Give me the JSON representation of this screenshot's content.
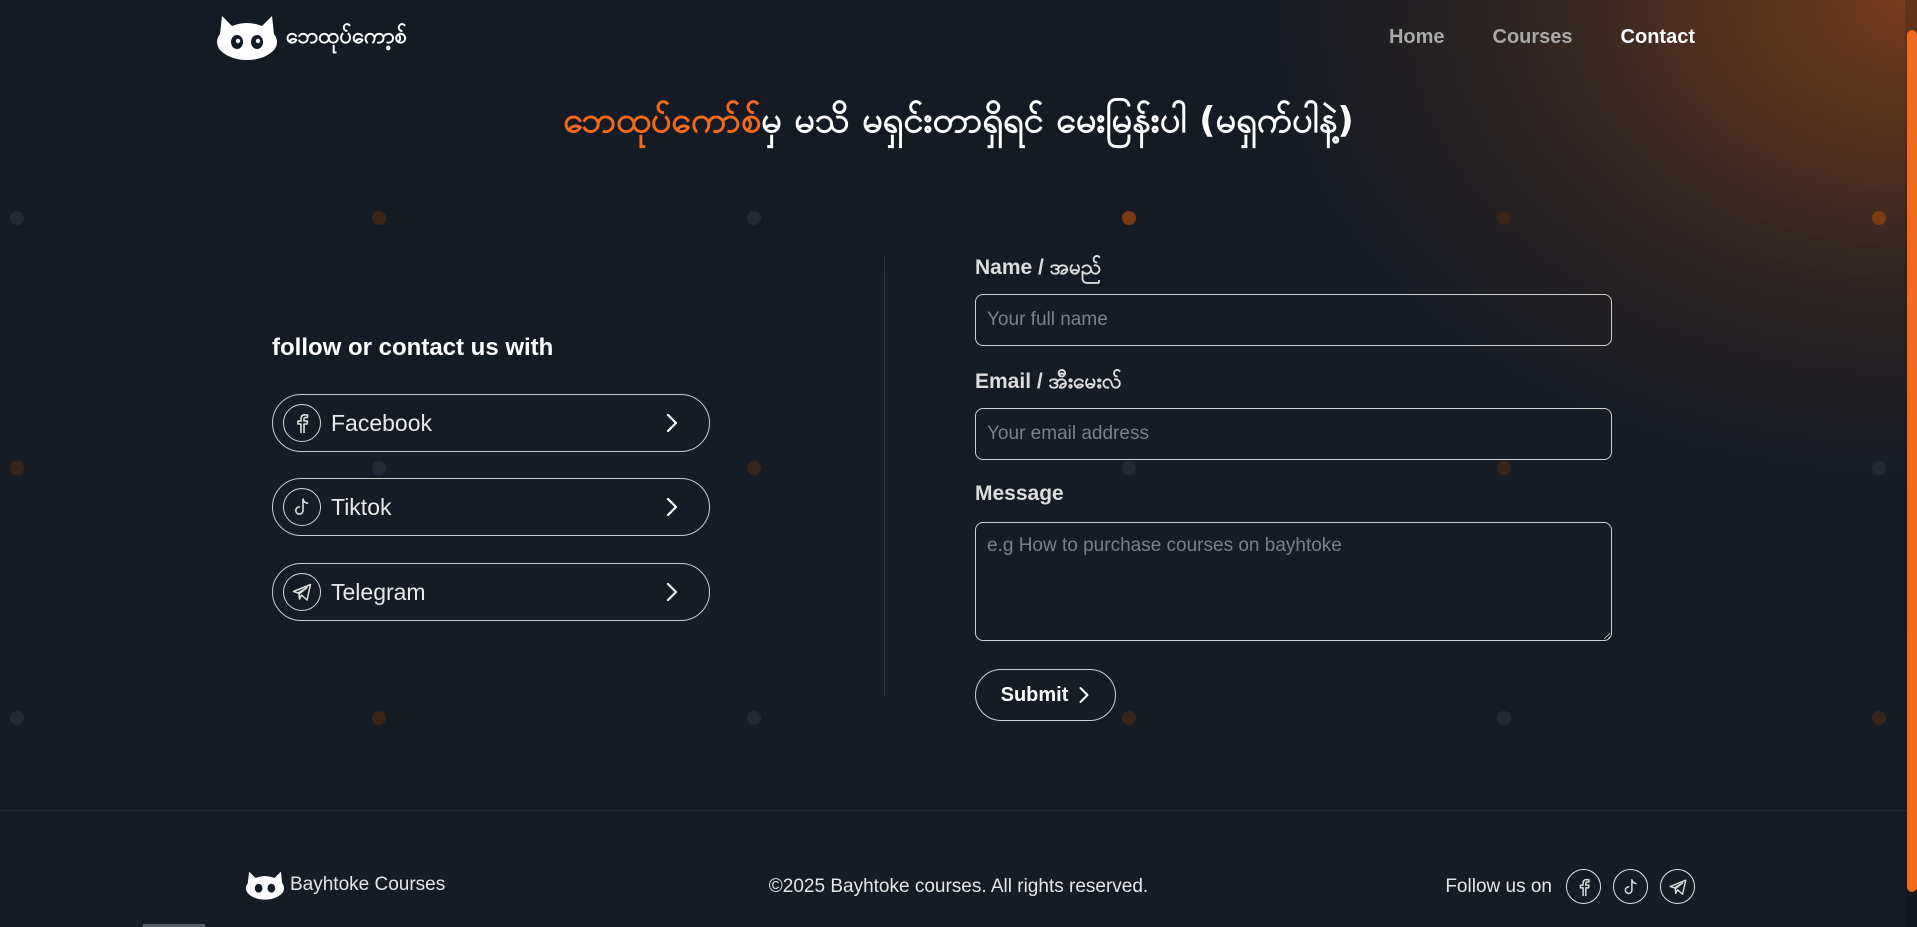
{
  "header": {
    "logo_text": "ဘေထုပ်ကော့စ်",
    "nav": [
      {
        "label": "Home",
        "active": false
      },
      {
        "label": "Courses",
        "active": false
      },
      {
        "label": "Contact",
        "active": true
      }
    ]
  },
  "headline": {
    "accent": "ဘေထုပ်ကော်စ်",
    "rest": "မှ မသိ မရှင်းတာရှိရင် မေးမြန်းပါ (မရှက်ပါနဲ့)"
  },
  "contact_links": {
    "title": "follow or contact us with",
    "items": [
      {
        "label": "Facebook",
        "icon": "facebook-icon"
      },
      {
        "label": "Tiktok",
        "icon": "tiktok-icon"
      },
      {
        "label": "Telegram",
        "icon": "telegram-icon"
      }
    ]
  },
  "form": {
    "name_label": "Name / အမည်",
    "name_placeholder": "Your full name",
    "email_label": "Email / အီးမေးလ်",
    "email_placeholder": "Your email address",
    "message_label": "Message",
    "message_placeholder": "e.g How to purchase courses on bayhtoke",
    "submit_label": "Submit"
  },
  "footer": {
    "brand": "Bayhtoke Courses",
    "copyright": "©2025 Bayhtoke courses. All rights reserved.",
    "follow_label": "Follow us on",
    "icons": [
      "facebook-icon",
      "tiktok-icon",
      "telegram-icon"
    ]
  },
  "colors": {
    "accent": "#f26a1b",
    "background": "#151b25"
  }
}
